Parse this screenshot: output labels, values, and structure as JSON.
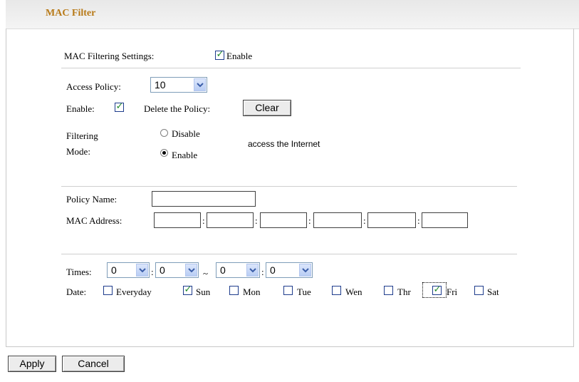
{
  "header": {
    "title": "MAC Filter"
  },
  "mac_filtering": {
    "label": "MAC Filtering Settings:",
    "enable_label": "Enable",
    "enabled": true
  },
  "policy": {
    "access_policy_label": "Access Policy:",
    "access_policy_value": "10",
    "enable_label": "Enable:",
    "enabled": true,
    "delete_label": "Delete the Policy:",
    "clear_button": "Clear"
  },
  "filtering_mode": {
    "label_line1": "Filtering",
    "label_line2": "Mode:",
    "options": [
      "Disable",
      "Enable"
    ],
    "selected": "Enable",
    "suffix": "access the Internet"
  },
  "policy_name": {
    "label": "Policy Name:",
    "value": ""
  },
  "mac_address": {
    "label": "MAC Address:",
    "octets": [
      "",
      "",
      "",
      "",
      "",
      ""
    ],
    "separator": ":"
  },
  "times": {
    "label": "Times:",
    "start_hour": "0",
    "start_minute": "0",
    "range_separator": "~",
    "end_hour": "0",
    "end_minute": "0",
    "separator": ":"
  },
  "date": {
    "label": "Date:",
    "days": [
      {
        "label": "Everyday",
        "checked": false
      },
      {
        "label": "Sun",
        "checked": true
      },
      {
        "label": "Mon",
        "checked": false
      },
      {
        "label": "Tue",
        "checked": false
      },
      {
        "label": "Wen",
        "checked": false
      },
      {
        "label": "Thr",
        "checked": false
      },
      {
        "label": "Fri",
        "checked": true
      },
      {
        "label": "Sat",
        "checked": false
      }
    ]
  },
  "footer": {
    "apply_button": "Apply",
    "cancel_button": "Cancel"
  },
  "icons": {
    "check": "check-icon",
    "dropdown": "chevron-down-icon"
  },
  "colors": {
    "title": "#b87a18",
    "check": "#1e8a28",
    "checkbox_border": "#1e3c8c"
  }
}
